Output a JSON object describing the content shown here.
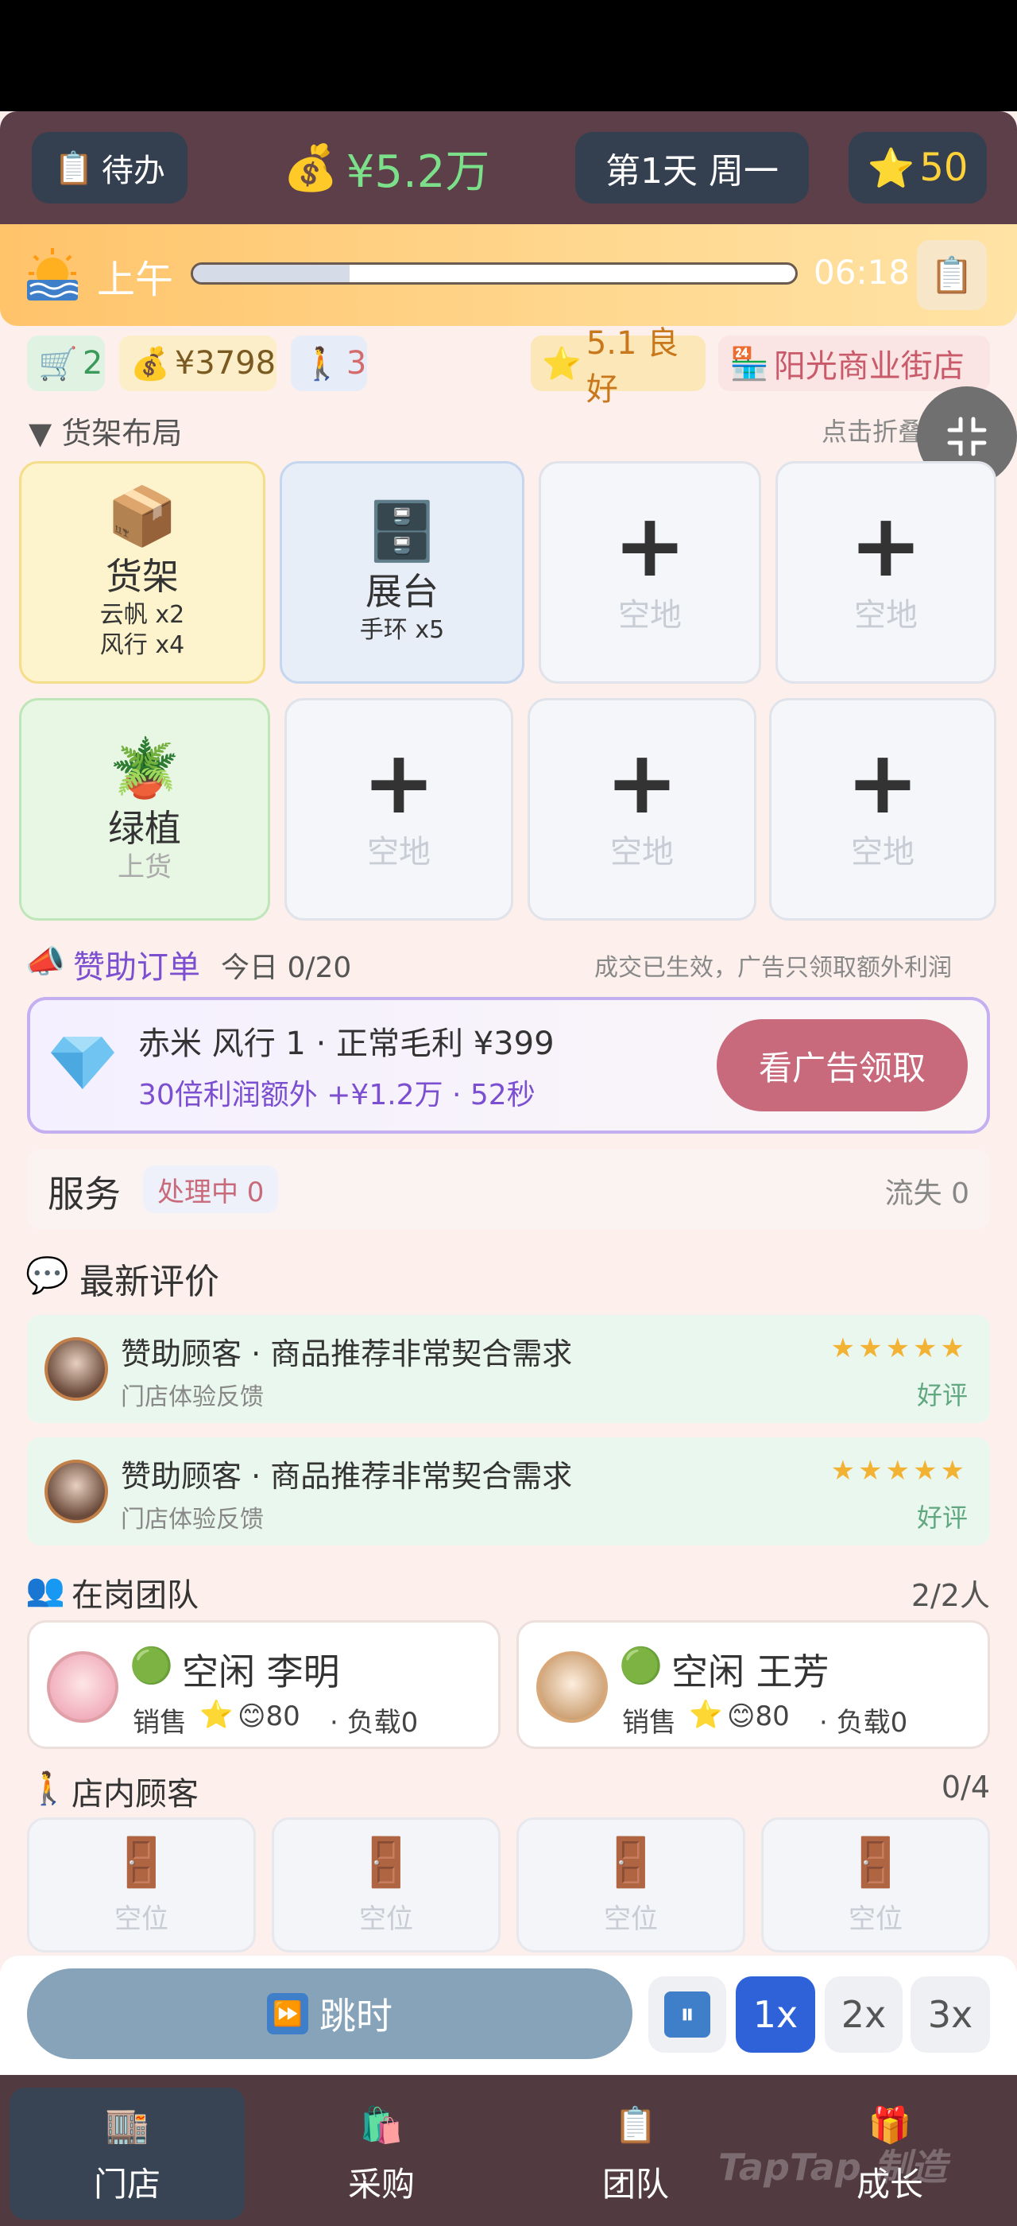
{
  "header": {
    "todo_icon": "📋",
    "todo_label": "待办",
    "money_icon": "💰",
    "money": "¥5.2万",
    "day": "第1天 周一",
    "star_icon": "⭐",
    "stars": "50"
  },
  "timebar": {
    "icon": "sunrise-icon",
    "period": "上午",
    "progress": 0.26,
    "time": "06:18",
    "clipboard_icon": "📋"
  },
  "stats": {
    "cart_icon": "🛒",
    "cart": "2",
    "money_icon": "💰",
    "money": "¥3798",
    "people_icon": "🚶",
    "people": "3",
    "rating_icon": "⭐",
    "rating": "5.1 良好",
    "store_icon": "🏪",
    "store": "阳光商业街店"
  },
  "shelf": {
    "title": "▼ 货架布局",
    "hint": "点击折叠/展开",
    "row1": [
      {
        "icon": "📦",
        "name": "货架",
        "lines": [
          "云帆 x2",
          "风行 x4"
        ]
      },
      {
        "icon": "🗄️",
        "name": "展台",
        "lines": [
          "手环 x5"
        ]
      },
      {
        "plus": "+",
        "empty": "空地"
      },
      {
        "plus": "+",
        "empty": "空地"
      }
    ],
    "row2": [
      {
        "icon": "🪴",
        "name": "绿植",
        "sub": "上货"
      },
      {
        "plus": "+",
        "empty": "空地"
      },
      {
        "plus": "+",
        "empty": "空地"
      },
      {
        "plus": "+",
        "empty": "空地"
      }
    ]
  },
  "sponsor": {
    "icon": "📣",
    "title": "赞助订单",
    "today": "今日 0/20",
    "note": "成交已生效，广告只领取额外利润",
    "gem_icon": "💎",
    "line1": "赤米 风行 1 · 正常毛利 ¥399",
    "line2": "30倍利润额外 +¥1.2万 · 52秒",
    "button": "看广告领取"
  },
  "service": {
    "title": "服务",
    "badge": "处理中 0",
    "lost": "流失 0"
  },
  "reviews": {
    "icon": "💬",
    "title": "最新评价",
    "items": [
      {
        "text": "赞助顾客 · 商品推荐非常契合需求",
        "sub": "门店体验反馈",
        "stars": "★★★★★",
        "label": "好评"
      },
      {
        "text": "赞助顾客 · 商品推荐非常契合需求",
        "sub": "门店体验反馈",
        "stars": "★★★★★",
        "label": "好评"
      }
    ]
  },
  "team": {
    "icon": "👥",
    "title": "在岗团队",
    "count": "2/2人",
    "members": [
      {
        "status_icon": "🟢",
        "status": "空闲 李明",
        "role": "销售",
        "star": "⭐",
        "mood": "😊80",
        "load": "· 负载0"
      },
      {
        "status_icon": "🟢",
        "status": "空闲 王芳",
        "role": "销售",
        "star": "⭐",
        "mood": "😊80",
        "load": "· 负载0"
      }
    ]
  },
  "customers": {
    "icon": "🚶",
    "title": "店内顾客",
    "count": "0/4",
    "slots": [
      {
        "icon": "🚪",
        "label": "空位"
      },
      {
        "icon": "🚪",
        "label": "空位"
      },
      {
        "icon": "🚪",
        "label": "空位"
      },
      {
        "icon": "🚪",
        "label": "空位"
      }
    ]
  },
  "controls": {
    "skip_icon": "⏩",
    "skip": "跳时",
    "pause": "⏸",
    "speed1": "1x",
    "speed2": "2x",
    "speed3": "3x"
  },
  "nav": {
    "items": [
      {
        "icon": "🏬",
        "label": "门店"
      },
      {
        "icon": "🛍️",
        "label": "采购"
      },
      {
        "icon": "📋",
        "label": "团队"
      },
      {
        "icon": "🎁",
        "label": "成长"
      }
    ],
    "watermark": "TapTap 制造"
  },
  "colors": {
    "header_bg": "#5c3f48",
    "money_green": "#7ce08a",
    "accent_blue": "#2f62d8",
    "ad_button": "#c8697c",
    "purple": "#7b4fd0"
  }
}
